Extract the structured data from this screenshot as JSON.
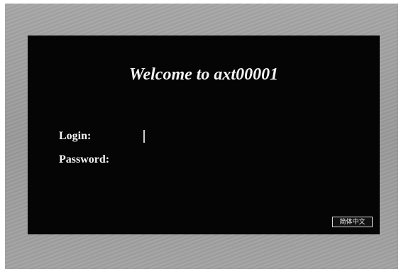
{
  "window": {
    "title": "Welcome to axt00001"
  },
  "form": {
    "login_label": "Login:",
    "login_value": "",
    "password_label": "Password:",
    "password_value": ""
  },
  "language_button": {
    "label": "简体中文"
  },
  "colors": {
    "panel_background": "#050505",
    "wallpaper_gray": "#9e9e9e",
    "text": "#f4f4f4"
  }
}
